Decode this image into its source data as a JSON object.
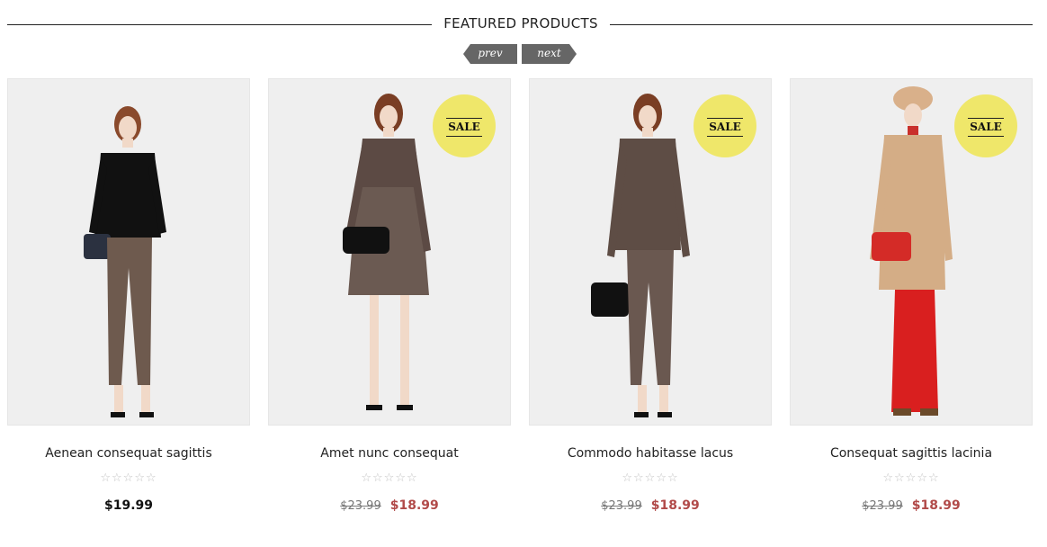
{
  "section": {
    "title": "FEATURED PRODUCTS"
  },
  "pager": {
    "prev_label": "prev",
    "next_label": "next"
  },
  "colors": {
    "sale_badge": "#efe76a",
    "sale_price": "#b14a49",
    "pager_bg": "#666666"
  },
  "products": [
    {
      "name": "Aenean consequat sagittis",
      "rating": "☆☆☆☆☆",
      "price": "$19.99",
      "old_price": "",
      "sale": false,
      "sale_label": ""
    },
    {
      "name": "Amet nunc consequat",
      "rating": "☆☆☆☆☆",
      "price": "$18.99",
      "old_price": "$23.99",
      "sale": true,
      "sale_label": "SALE"
    },
    {
      "name": "Commodo habitasse lacus",
      "rating": "☆☆☆☆☆",
      "price": "$18.99",
      "old_price": "$23.99",
      "sale": true,
      "sale_label": "SALE"
    },
    {
      "name": "Consequat sagittis lacinia",
      "rating": "☆☆☆☆☆",
      "price": "$18.99",
      "old_price": "$23.99",
      "sale": true,
      "sale_label": "SALE"
    }
  ]
}
